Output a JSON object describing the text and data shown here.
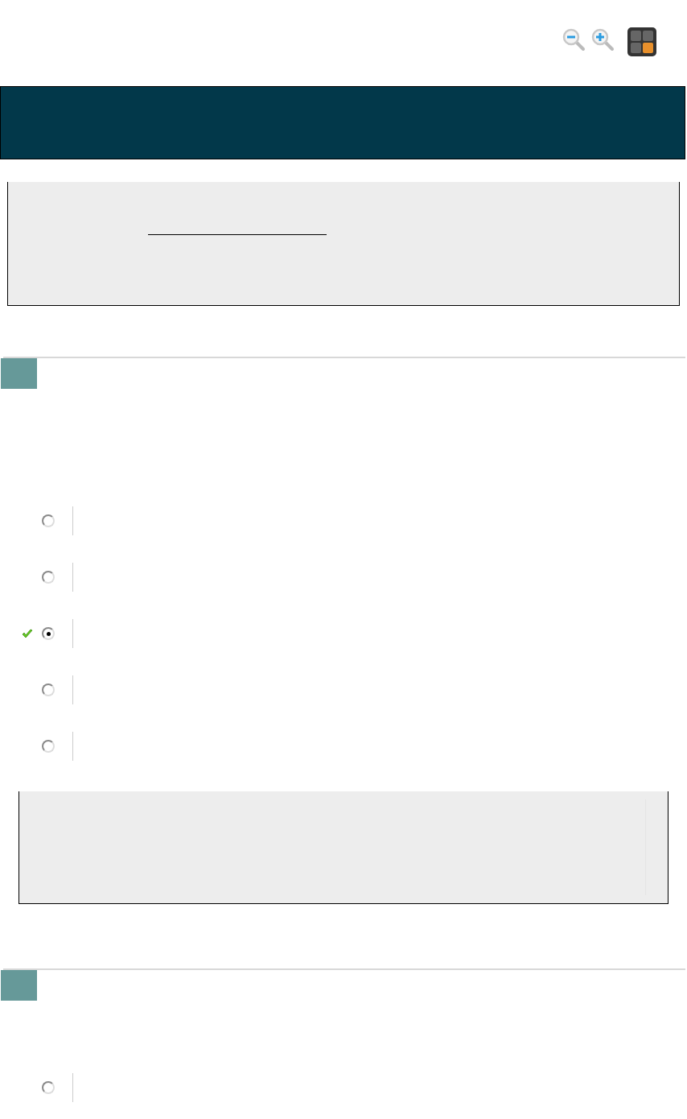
{
  "questions": [
    {
      "options": [
        {
          "selected": false,
          "correct": false
        },
        {
          "selected": false,
          "correct": false
        },
        {
          "selected": true,
          "correct": true
        },
        {
          "selected": false,
          "correct": false
        },
        {
          "selected": false,
          "correct": false
        }
      ],
      "feedback": true
    },
    {
      "options": [
        {
          "selected": false,
          "correct": false
        }
      ],
      "feedback": false
    }
  ]
}
